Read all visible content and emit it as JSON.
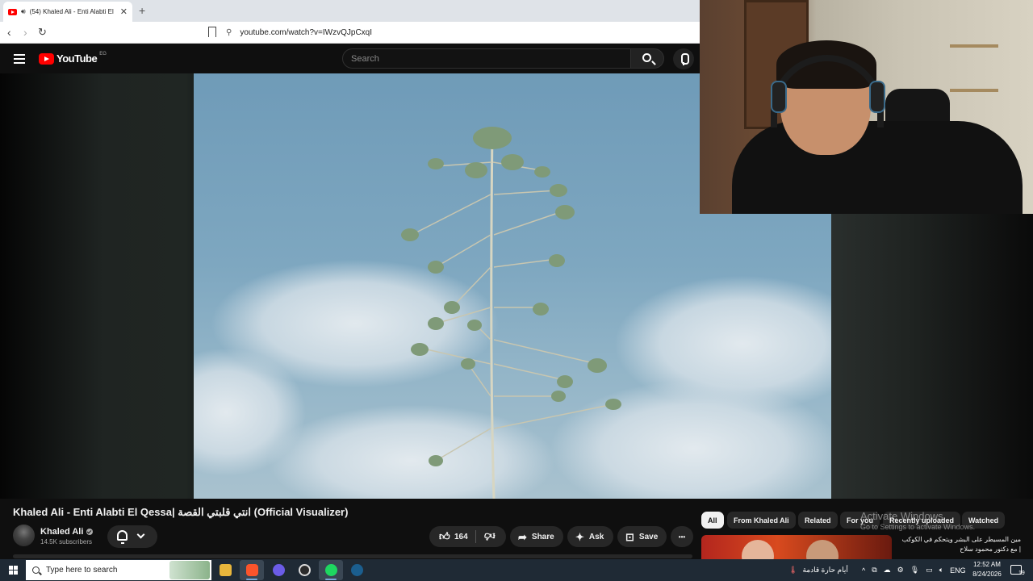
{
  "browser": {
    "tab_title": "(54) Khaled Ali - Enti Alabti El",
    "tab_close": "✕",
    "new_tab": "+",
    "url": "youtube.com/watch?v=IWzvQJpCxqI"
  },
  "youtube": {
    "logo_text": "YouTube",
    "country_code": "EG",
    "search_placeholder": "Search"
  },
  "video": {
    "title": "Khaled Ali - Enti Alabti El Qessa| انتي قلبتي القصة (Official Visualizer)",
    "channel_name": "Khaled Ali",
    "subscribers": "14.5K subscribers",
    "like_count": "164",
    "share_label": "Share",
    "ask_label": "Ask",
    "save_label": "Save",
    "more_label": "•••"
  },
  "chips": [
    "All",
    "From Khaled Ali",
    "Related",
    "For you",
    "Recently uploaded",
    "Watched"
  ],
  "watermark": {
    "line1": "Activate Windows",
    "line2": "Go to Settings to activate Windows."
  },
  "recommendation": {
    "title": "مين المسيطر على البشر ويتحكم في الكوكب | مع دكتور محمود سلاح"
  },
  "taskbar": {
    "search_placeholder": "Type here to search",
    "news_text": "أيام حارة قادمة",
    "language": "ENG",
    "time": "12:52 AM",
    "date": "8/24/2026",
    "notification_count": "19"
  },
  "colors": {
    "youtube_red": "#ff0000",
    "page_bg": "#0f0f0f",
    "taskbar_bg": "#1f2a35"
  }
}
